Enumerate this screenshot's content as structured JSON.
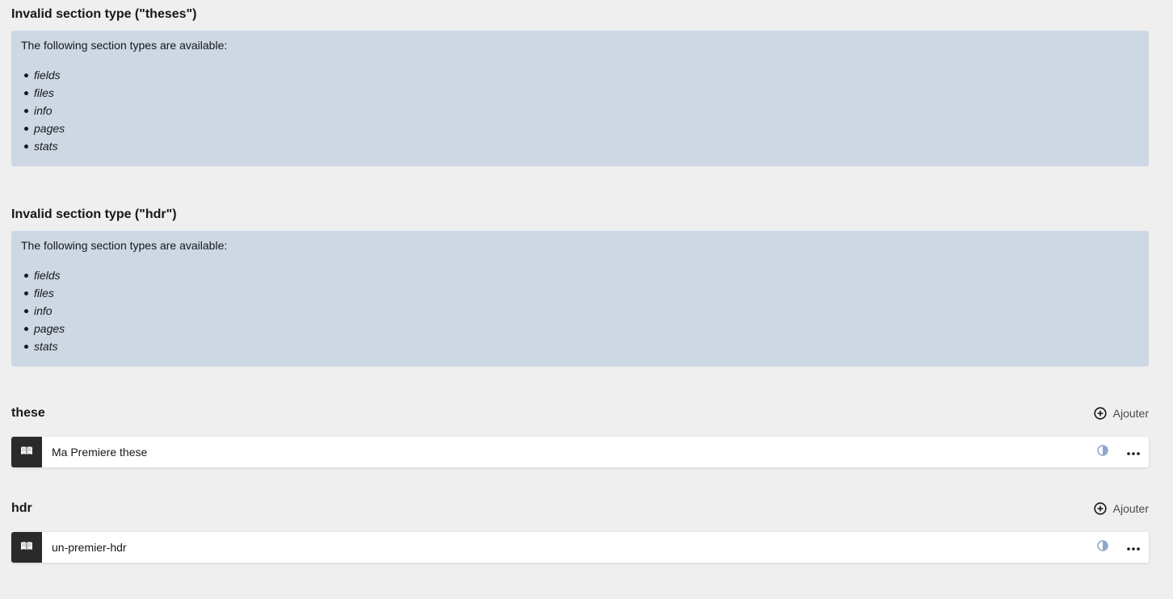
{
  "errors": [
    {
      "title": "Invalid section type (\"theses\")",
      "message": "The following section types are available:",
      "types": [
        "fields",
        "files",
        "info",
        "pages",
        "stats"
      ]
    },
    {
      "title": "Invalid section type (\"hdr\")",
      "message": "The following section types are available:",
      "types": [
        "fields",
        "files",
        "info",
        "pages",
        "stats"
      ]
    }
  ],
  "sections": [
    {
      "title": "these",
      "add_label": "Ajouter",
      "items": [
        {
          "title": "Ma Premiere these",
          "icon": "book-icon",
          "status": "unlisted"
        }
      ]
    },
    {
      "title": "hdr",
      "add_label": "Ajouter",
      "items": [
        {
          "title": "un-premier-hdr",
          "icon": "book-icon",
          "status": "unlisted"
        }
      ]
    }
  ],
  "colors": {
    "background": "#efefef",
    "info_box": "#cdd8e4",
    "status_unlisted": "#8fa6c9"
  }
}
